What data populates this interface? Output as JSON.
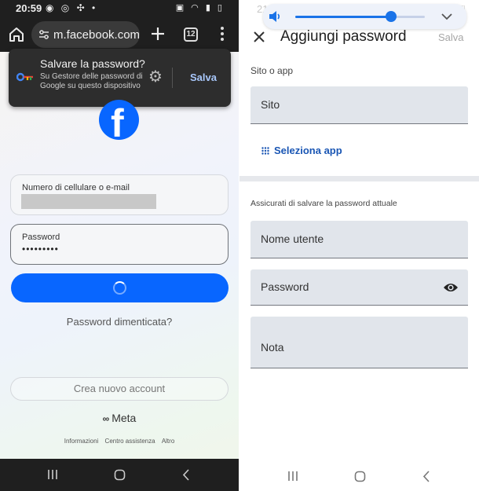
{
  "left_phone": {
    "status_bar": {
      "time": "20:59"
    },
    "browser": {
      "url": "m.facebook.com/",
      "tab_count": "12"
    },
    "save_password_popup": {
      "title": "Salvare la password?",
      "subtitle": "Su Gestore delle password di Google su questo dispositivo",
      "save_label": "Salva"
    },
    "login_form": {
      "phone_email_label": "Numero di cellulare o e-mail",
      "password_label": "Password",
      "password_value": "•••••••••",
      "forgot_password": "Password dimenticata?",
      "create_account": "Crea nuovo account",
      "meta_logo": "Meta",
      "footer_links": [
        "Informazioni",
        "Centro assistenza",
        "Altro"
      ]
    },
    "colors": {
      "facebook_blue": "#0866ff",
      "popup_bg": "#2d2d2d"
    }
  },
  "right_phone": {
    "status_bar": {
      "time": "21:00"
    },
    "volume": {
      "level": 0.74
    },
    "header": {
      "title": "Aggiungi password",
      "save_label": "Salva"
    },
    "site_section": {
      "label": "Sito o app",
      "site_placeholder": "Sito",
      "select_app": "Seleziona app"
    },
    "credentials_section": {
      "label": "Assicurati di salvare la password attuale",
      "username_placeholder": "Nome utente",
      "password_placeholder": "Password",
      "note_placeholder": "Nota"
    },
    "colors": {
      "accent": "#1a73e8",
      "field_bg": "#e1e5eb"
    }
  }
}
